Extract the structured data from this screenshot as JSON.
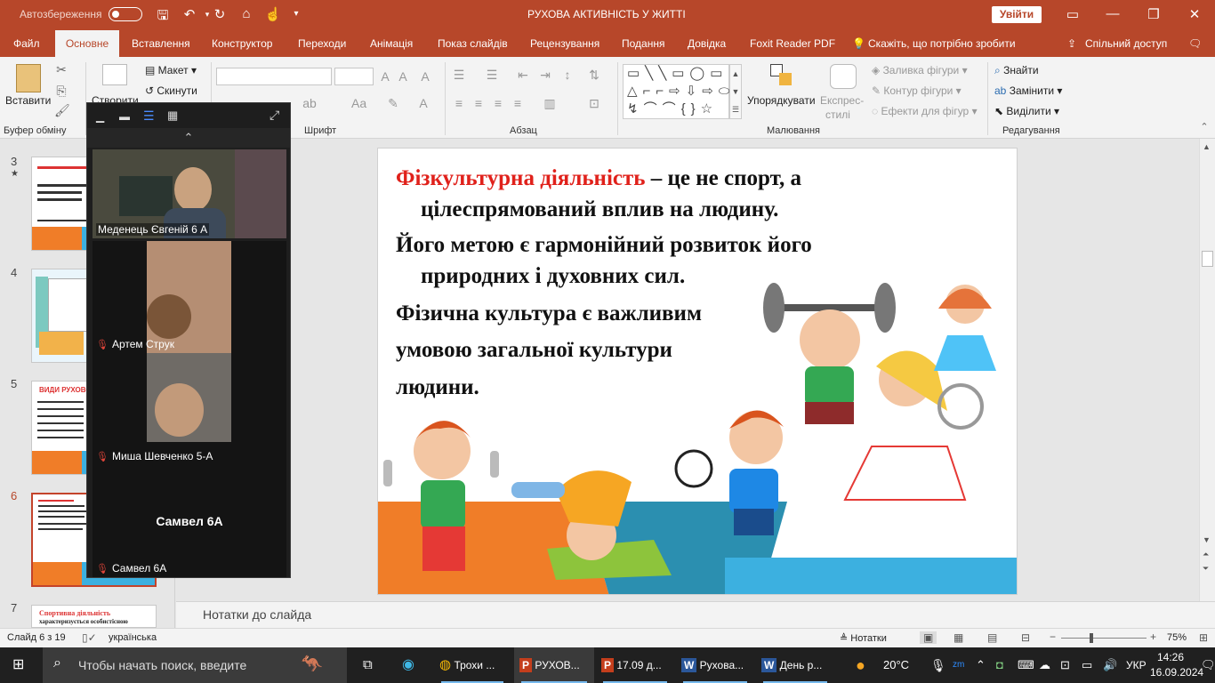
{
  "titlebar": {
    "autosave_label": "Автозбереження",
    "title": "РУХОВА АКТИВНІСТЬ У ЖИТТІ",
    "signin": "Увійти"
  },
  "tabs": [
    "Файл",
    "Основне",
    "Вставлення",
    "Конструктор",
    "Переходи",
    "Анімація",
    "Показ слайдів",
    "Рецензування",
    "Подання",
    "Довідка",
    "Foxit Reader PDF"
  ],
  "tell_me": "Скажіть, що потрібно зробити",
  "share": "Спільний доступ",
  "ribbon": {
    "paste": "Вставити",
    "create": "Створити",
    "layout": "Макет",
    "reset": "Скинути",
    "arrange": "Упорядкувати",
    "quick_styles_1": "Експрес-",
    "quick_styles_2": "стилі",
    "fill": "Заливка фігури",
    "outline": "Контур фігури",
    "effects": "Ефекти для фігур",
    "find": "Знайти",
    "replace": "Замінити",
    "select": "Виділити",
    "groups": {
      "clipboard": "Буфер обміну",
      "font": "Шрифт",
      "paragraph": "Абзац",
      "drawing": "Малювання",
      "editing": "Редагування"
    }
  },
  "thumbnails": [
    {
      "num": "3",
      "star": "★"
    },
    {
      "num": "4"
    },
    {
      "num": "5",
      "caption": "ВИДИ РУХОВОЇ"
    },
    {
      "num": "6"
    },
    {
      "num": "7",
      "caption1": "Спортивна діяльність",
      "caption2": "характеризується особистісною"
    }
  ],
  "zoom": {
    "participants": [
      {
        "name": "Меденець Євгеній 6 А"
      },
      {
        "name": "Артем Струк"
      },
      {
        "name": "Миша Шевченко 5-А"
      },
      {
        "name": "Самвел 6А",
        "center": "Самвел 6А"
      }
    ]
  },
  "slide": {
    "line1_red": "Фізкультурна діяльність",
    "line1_rest": " – це не спорт, а",
    "line2": "цілеспрямований вплив на людину.",
    "line3": "Його метою є гармонійний розвиток його",
    "line4": "природних і духовних сил.",
    "line5": "Фізична культура є важливим",
    "line6": "умовою загальної культури",
    "line7": "людини."
  },
  "notes_placeholder": "Нотатки до слайда",
  "status": {
    "slide_info": "Слайд 6 з 19",
    "language": "українська",
    "notes": "Нотатки",
    "zoom": "75%"
  },
  "taskbar": {
    "search": "Чтобы начать поиск, введите",
    "apps": [
      {
        "label": "Трохи ..."
      },
      {
        "label": "РУХОВ..."
      },
      {
        "label": "17.09 д..."
      },
      {
        "label": "Рухова..."
      },
      {
        "label": "День р..."
      }
    ],
    "weather": "20°C",
    "lang": "УКР",
    "time": "14:26",
    "date": "16.09.2024"
  },
  "colors": {
    "accent": "#b7472a",
    "red_text": "#e0211b"
  }
}
